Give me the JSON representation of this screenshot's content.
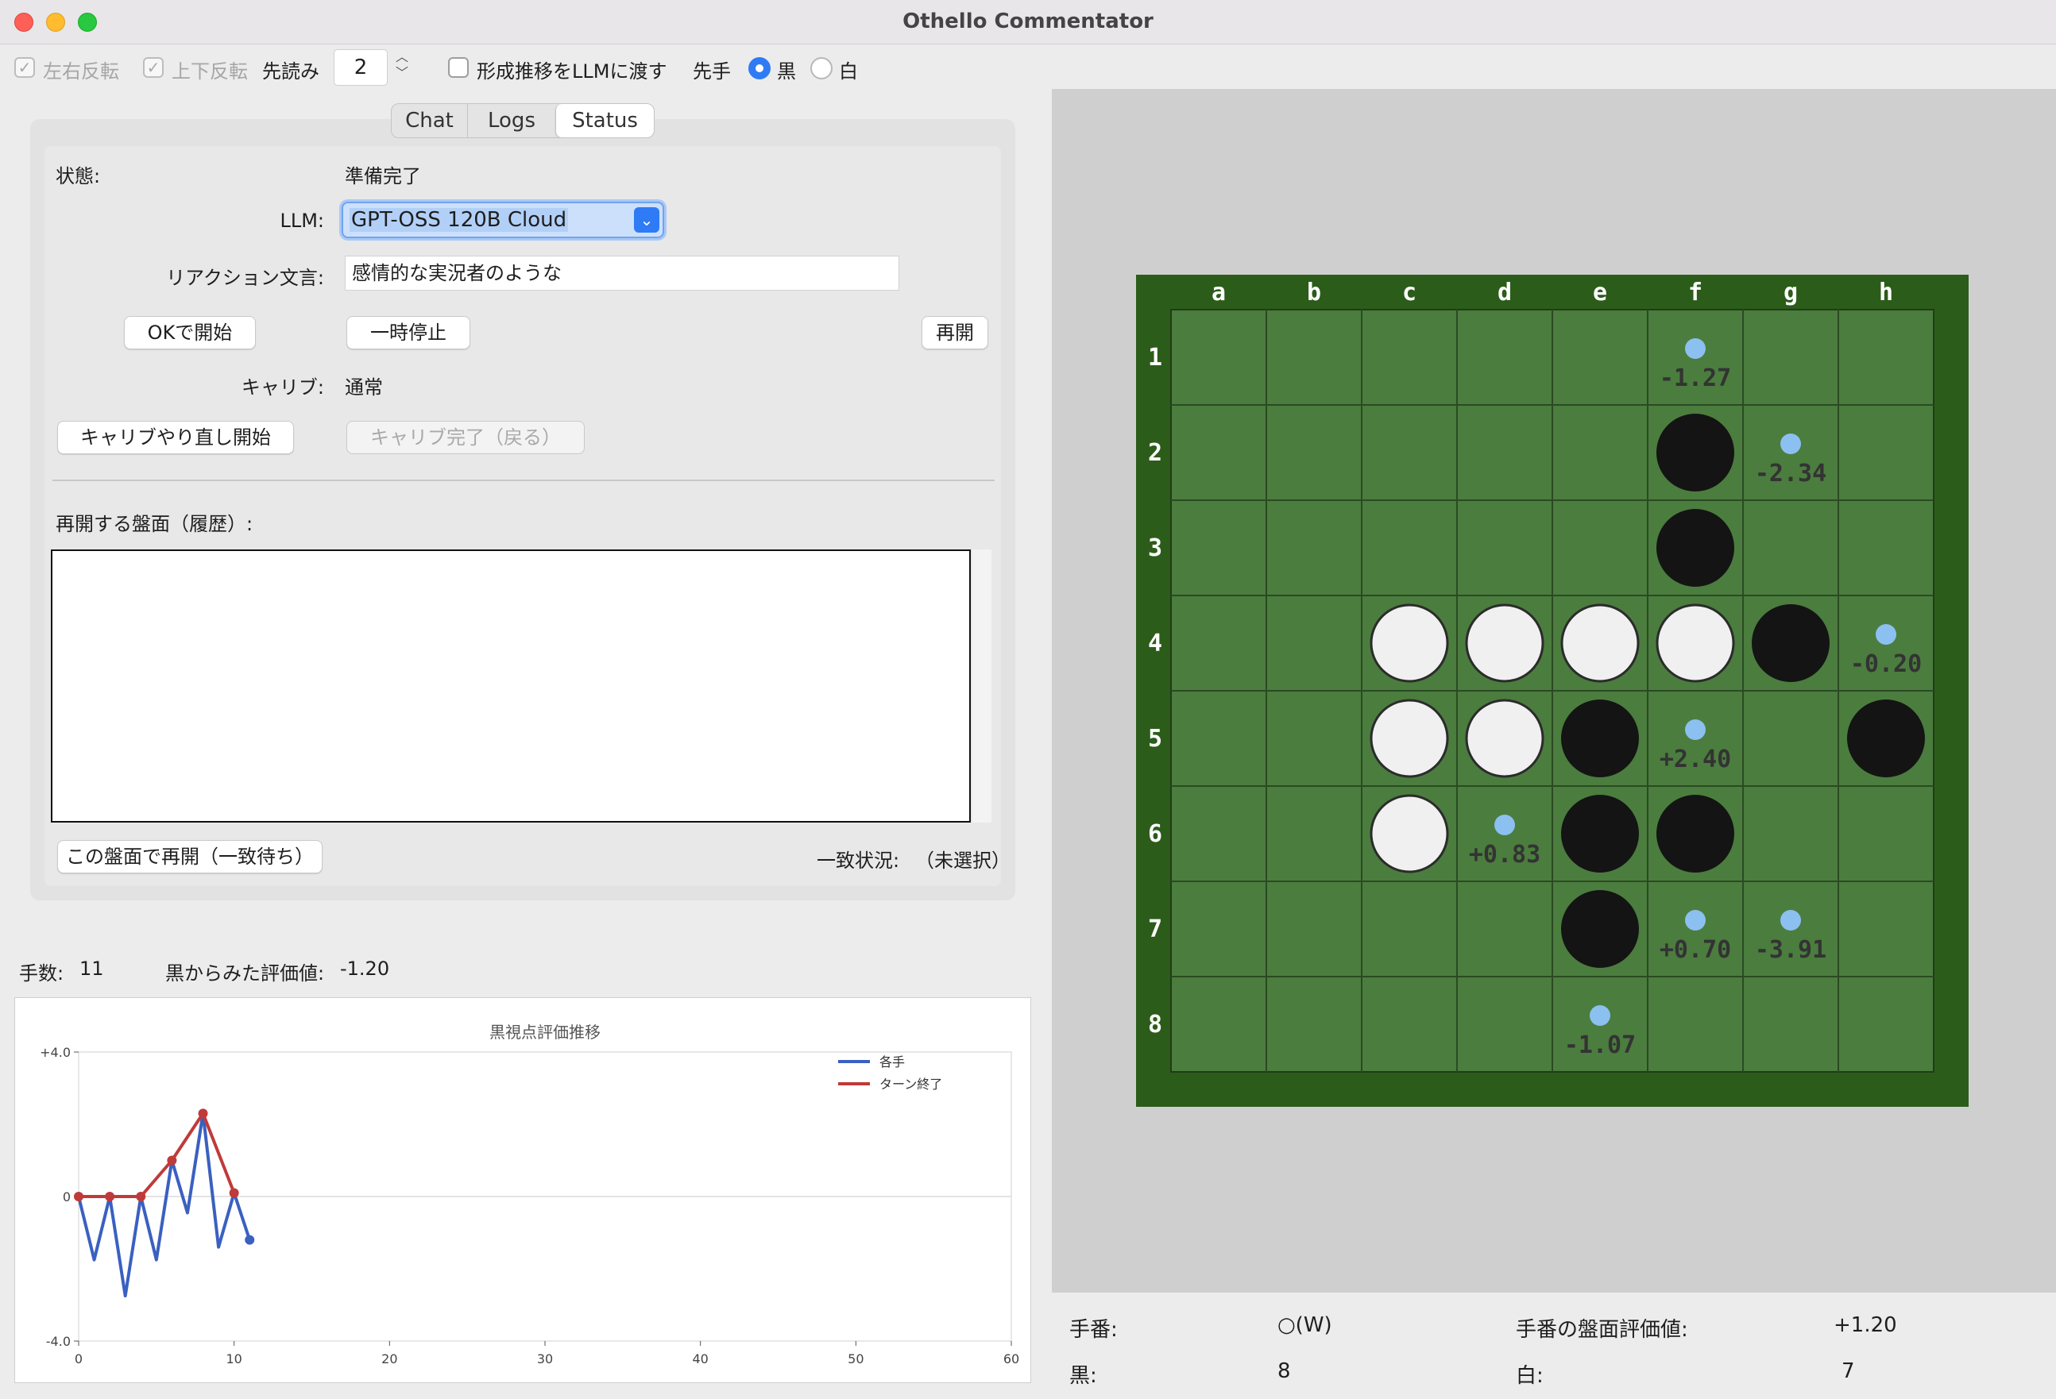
{
  "window": {
    "title": "Othello Commentator"
  },
  "toolbar": {
    "flip_lr": "左右反転",
    "flip_ud": "上下反転",
    "lookahead_label": "先読み",
    "lookahead_value": "2",
    "pass_history": "形成推移をLLMに渡す",
    "first_player_label": "先手",
    "black": "黒",
    "white": "白"
  },
  "tabs": [
    "Chat",
    "Logs",
    "Status"
  ],
  "status": {
    "state_label": "状態:",
    "state_value": "準備完了",
    "llm_label": "LLM:",
    "llm_value": "GPT-OSS 120B Cloud",
    "reaction_label": "リアクション文言:",
    "reaction_value": "感情的な実況者のような",
    "start_button": "OKで開始",
    "pause_button": "一時停止",
    "resume_button": "再開",
    "calib_label": "キャリブ:",
    "calib_value": "通常",
    "recalib_button": "キャリブやり直し開始",
    "calib_done_button": "キャリブ完了（戻る）",
    "history_label": "再開する盤面（履歴）:",
    "resume_board_button": "この盤面で再開（一致待ち）",
    "match_label": "一致状況:",
    "match_value": "（未選択）"
  },
  "stats": {
    "moves_label": "手数:",
    "moves_value": "11",
    "eval_label": "黒からみた評価値:",
    "eval_value": "-1.20"
  },
  "chart_data": {
    "type": "line",
    "title": "黒視点評価推移",
    "xlim": [
      0,
      60
    ],
    "ylim": [
      -4,
      4
    ],
    "xticks": [
      "0",
      "10",
      "20",
      "30",
      "40",
      "50",
      "60"
    ],
    "yticks": [
      "+4.0",
      "0",
      "-4.0"
    ],
    "legend_position": "top-right",
    "series": [
      {
        "name": "各手",
        "color": "#3a60c0",
        "x": [
          0,
          1,
          2,
          3,
          4,
          5,
          6,
          7,
          8,
          9,
          10,
          11
        ],
        "values": [
          0,
          -1.75,
          0,
          -2.75,
          0,
          -1.75,
          1.0,
          -0.45,
          2.3,
          -1.4,
          0.1,
          -1.2
        ]
      },
      {
        "name": "ターン終了",
        "color": "#c03a3a",
        "x": [
          0,
          2,
          4,
          6,
          8,
          10
        ],
        "values": [
          0,
          0,
          0,
          1.0,
          2.3,
          0.1
        ]
      }
    ]
  },
  "board": {
    "columns": [
      "a",
      "b",
      "c",
      "d",
      "e",
      "f",
      "g",
      "h"
    ],
    "rows": [
      "1",
      "2",
      "3",
      "4",
      "5",
      "6",
      "7",
      "8"
    ],
    "colors": {
      "felt": "#4b7d3e",
      "border": "#2c5c1a",
      "black": "#141414",
      "white": "#f0f0f0",
      "hint": "#8cc0f0"
    },
    "discs": [
      {
        "cell": "f2",
        "color": "black"
      },
      {
        "cell": "f3",
        "color": "black"
      },
      {
        "cell": "c4",
        "color": "white"
      },
      {
        "cell": "d4",
        "color": "white"
      },
      {
        "cell": "e4",
        "color": "white"
      },
      {
        "cell": "f4",
        "color": "white"
      },
      {
        "cell": "g4",
        "color": "black"
      },
      {
        "cell": "c5",
        "color": "white"
      },
      {
        "cell": "d5",
        "color": "white"
      },
      {
        "cell": "e5",
        "color": "black"
      },
      {
        "cell": "h5",
        "color": "black"
      },
      {
        "cell": "c6",
        "color": "white"
      },
      {
        "cell": "e6",
        "color": "black"
      },
      {
        "cell": "f6",
        "color": "black"
      },
      {
        "cell": "e7",
        "color": "black"
      }
    ],
    "hints": [
      {
        "cell": "f1",
        "value": "-1.27"
      },
      {
        "cell": "g2",
        "value": "-2.34"
      },
      {
        "cell": "h4",
        "value": "-0.20"
      },
      {
        "cell": "f5",
        "value": "+2.40"
      },
      {
        "cell": "d6",
        "value": "+0.83"
      },
      {
        "cell": "f7",
        "value": "+0.70"
      },
      {
        "cell": "g7",
        "value": "-3.91"
      },
      {
        "cell": "e8",
        "value": "-1.07"
      }
    ]
  },
  "info": {
    "turn_label": "手番:",
    "turn_value": "○(W)",
    "turn_eval_label": "手番の盤面評価値:",
    "turn_eval_value": "+1.20",
    "black_label": "黒:",
    "black_value": "8",
    "white_label": "白:",
    "white_value": "7"
  }
}
